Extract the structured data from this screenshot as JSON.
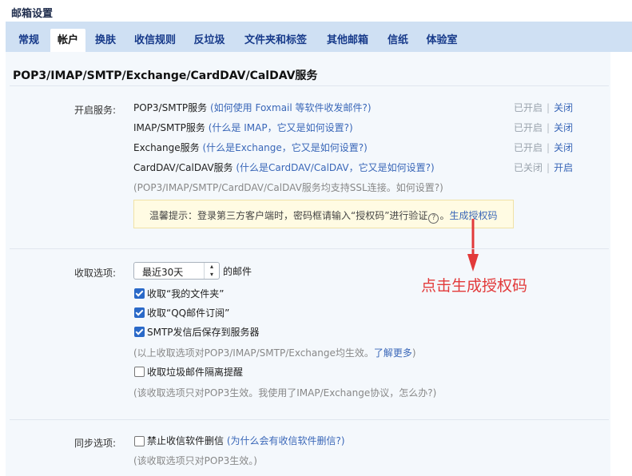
{
  "header": {
    "title": "邮箱设置"
  },
  "tabs": [
    {
      "label": "常规"
    },
    {
      "label": "帐户"
    },
    {
      "label": "换肤"
    },
    {
      "label": "收信规则"
    },
    {
      "label": "反垃圾"
    },
    {
      "label": "文件夹和标签"
    },
    {
      "label": "其他邮箱"
    },
    {
      "label": "信纸"
    },
    {
      "label": "体验室"
    }
  ],
  "section": {
    "title": "POP3/IMAP/SMTP/Exchange/CardDAV/CalDAV服务"
  },
  "services": {
    "label": "开启服务:",
    "items": [
      {
        "name": "POP3/SMTP服务",
        "help": "(如何使用 Foxmail 等软件收发邮件?)",
        "status": "已开启",
        "action": "关闭"
      },
      {
        "name": "IMAP/SMTP服务",
        "help": "(什么是 IMAP，它又是如何设置?)",
        "status": "已开启",
        "action": "关闭"
      },
      {
        "name": "Exchange服务",
        "help": "(什么是Exchange，它又是如何设置?)",
        "status": "已开启",
        "action": "关闭"
      },
      {
        "name": "CardDAV/CalDAV服务",
        "help": "(什么是CardDAV/CalDAV，它又是如何设置?)",
        "status": "已关闭",
        "action": "开启"
      }
    ],
    "ssl_note": "(POP3/IMAP/SMTP/CardDAV/CalDAV服务均支持SSL连接。如何设置?)",
    "tip": {
      "text": "温馨提示：登录第三方客户端时，密码框请输入“授权码”进行验证",
      "icon": "question-circle-icon",
      "link": "生成授权码"
    }
  },
  "receive": {
    "label": "收取选项:",
    "range_value": "最近30天",
    "range_suffix": "的邮件",
    "options": [
      {
        "label": "收取“我的文件夹”",
        "checked": true
      },
      {
        "label": "收取“QQ邮件订阅”",
        "checked": true
      },
      {
        "label": "SMTP发信后保存到服务器",
        "checked": true
      }
    ],
    "note1_pre": "(以上收取选项对POP3/IMAP/SMTP/Exchange均生效。",
    "note1_link": "了解更多",
    "note1_post": ")",
    "spam_label": "收取垃圾邮件隔离提醒",
    "spam_checked": false,
    "note2": "(该收取选项只对POP3生效。我使用了IMAP/Exchange协议，怎么办?)"
  },
  "sync": {
    "label": "同步选项:",
    "option": "禁止收信软件删信",
    "option_checked": false,
    "help": "(为什么会有收信软件删信?)",
    "note": "(该收取选项只对POP3生效。)"
  },
  "annotation": {
    "text": "点击生成授权码",
    "color": "#e23a3a"
  },
  "colors": {
    "tab_bar": "#cfe0f3",
    "link": "#3a67b8",
    "checkbox": "#2a69c8"
  }
}
